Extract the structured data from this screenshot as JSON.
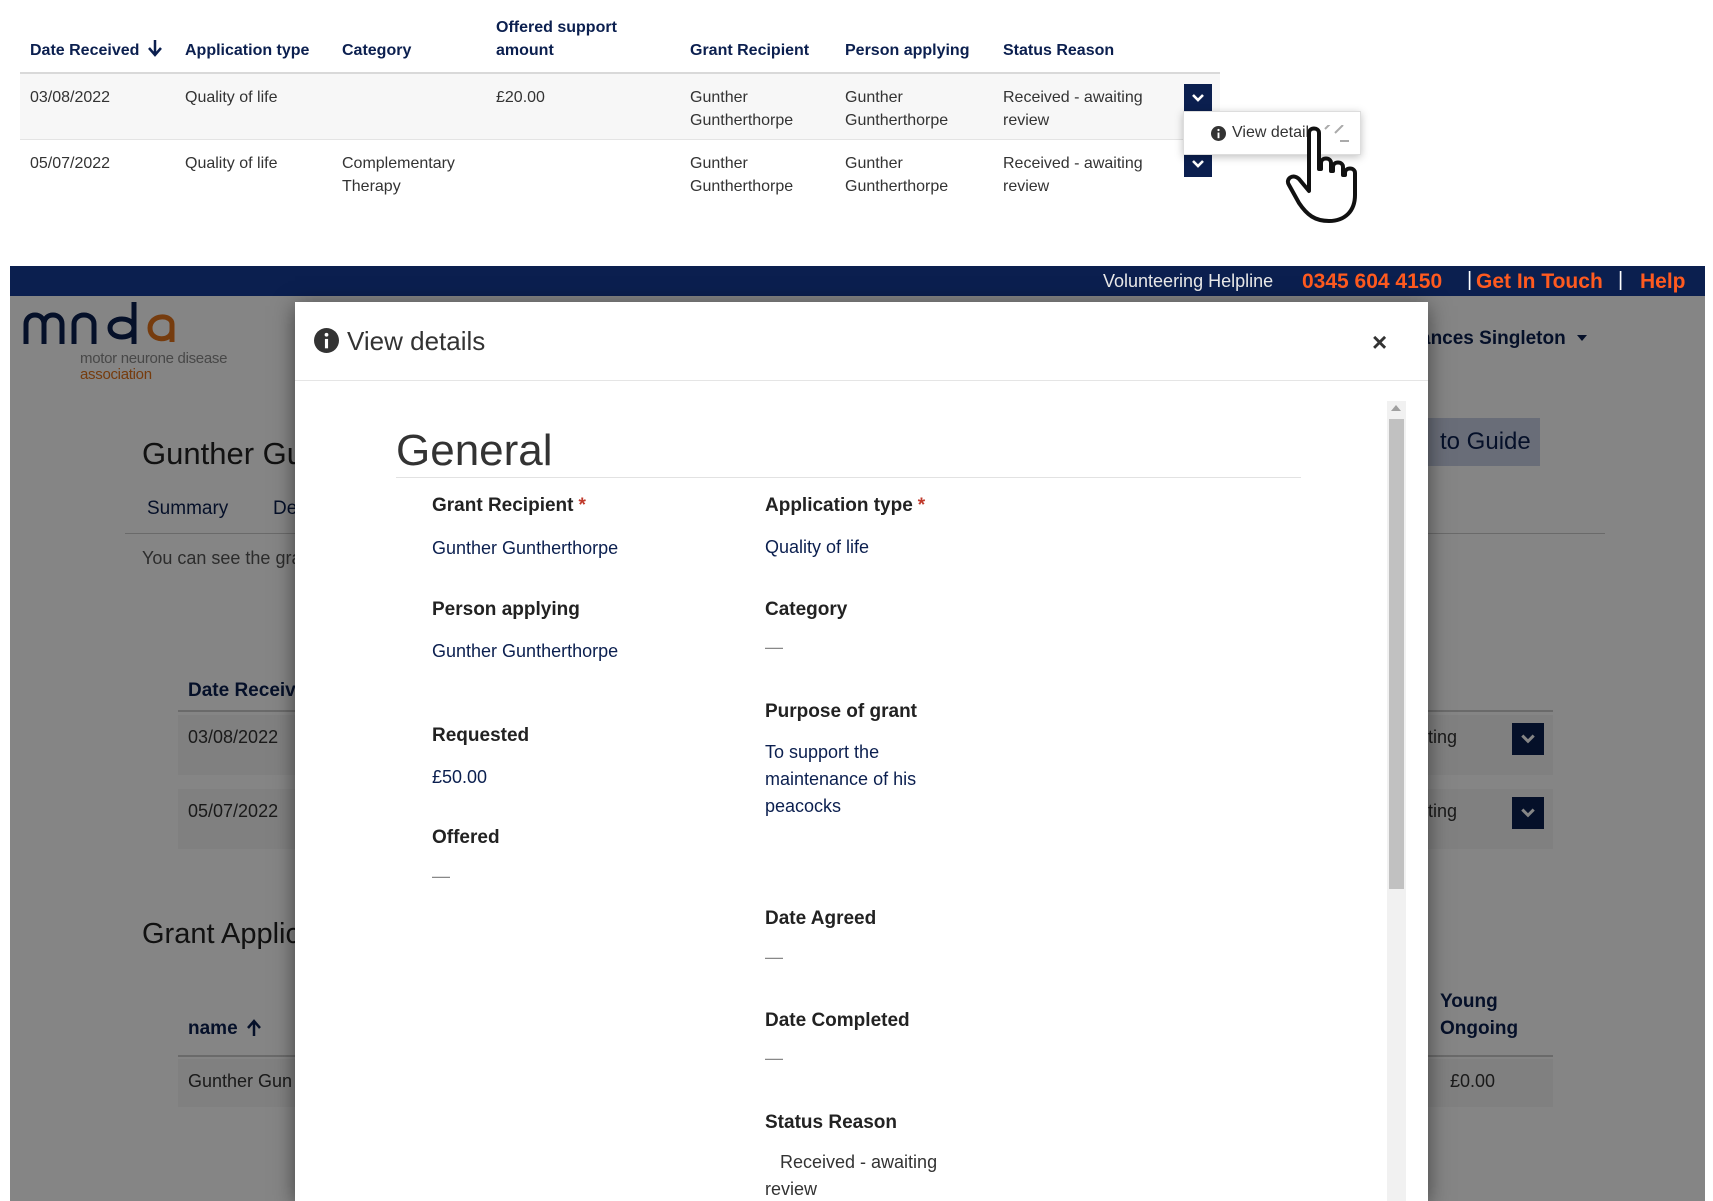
{
  "excerpt": {
    "headers": {
      "date_received": "Date Received",
      "application_type": "Application type",
      "category": "Category",
      "offered_line1": "Offered support",
      "offered_line2": "amount",
      "grant_recipient": "Grant Recipient",
      "person_applying": "Person applying",
      "status_reason": "Status Reason"
    },
    "rows": [
      {
        "date": "03/08/2022",
        "type": "Quality of life",
        "category": "",
        "offered": "£20.00",
        "recipient_l1": "Gunther",
        "recipient_l2": "Guntherthorpe",
        "person_l1": "Gunther",
        "person_l2": "Guntherthorpe",
        "status_l1": "Received - awaiting",
        "status_l2": "review"
      },
      {
        "date": "05/07/2022",
        "type": "Quality of life",
        "category_l1": "Complementary",
        "category_l2": "Therapy",
        "offered": "",
        "recipient_l1": "Gunther",
        "recipient_l2": "Guntherthorpe",
        "person_l1": "Gunther",
        "person_l2": "Guntherthorpe",
        "status_l1": "Received - awaiting",
        "status_l2": "review"
      }
    ],
    "popup_label": "View details"
  },
  "app": {
    "topbar": {
      "helpline_label": "Volunteering Helpline",
      "phone": "0345 604 4150",
      "sep": "|",
      "get_in_touch": "Get In Touch",
      "help": "Help"
    },
    "logo": {
      "wordmark": "mnda",
      "line1": "motor neurone disease",
      "line2": "association"
    },
    "user_menu": "ances Singleton",
    "guide_button": "to Guide",
    "person_title": "Gunther Gu",
    "tabs": [
      "Summary",
      "De"
    ],
    "intro": "You can see the gra",
    "table_header": "Date Receiv",
    "rows": [
      {
        "date": "03/08/2022",
        "status": "ting"
      },
      {
        "date": "05/07/2022",
        "status": "ting"
      }
    ],
    "grants_title": "Grant Applic",
    "grants_header_name": "name",
    "grants_header_young_l1": "Young",
    "grants_header_young_l2": "Ongoing",
    "grants_row": {
      "name": "Gunther Gun",
      "value": "£0.00"
    }
  },
  "modal": {
    "title": "View details",
    "close": "×",
    "section": "General",
    "fields": {
      "grant_recipient_label": "Grant Recipient",
      "grant_recipient_value": "Gunther Guntherthorpe",
      "application_type_label": "Application type",
      "application_type_value": "Quality of life",
      "person_applying_label": "Person applying",
      "person_applying_value": "Gunther Guntherthorpe",
      "category_label": "Category",
      "category_value": "—",
      "purpose_label": "Purpose of grant",
      "purpose_value": "To support the maintenance of his peacocks",
      "requested_label": "Requested",
      "requested_value": "£50.00",
      "offered_label": "Offered",
      "offered_value": "—",
      "date_agreed_label": "Date Agreed",
      "date_agreed_value": "—",
      "date_completed_label": "Date Completed",
      "date_completed_value": "—",
      "status_reason_label": "Status Reason",
      "status_reason_value": "Received - awaiting review"
    },
    "required_mark": "*"
  },
  "colors": {
    "navy": "#0b1f4f",
    "accent_orange": "#ff5a1f",
    "required_red": "#c0392b"
  },
  "icons": [
    "arrow-down-icon",
    "chevron-down-icon",
    "info-icon",
    "hand-cursor-icon",
    "caret-down-icon",
    "arrow-up-icon",
    "close-icon"
  ]
}
